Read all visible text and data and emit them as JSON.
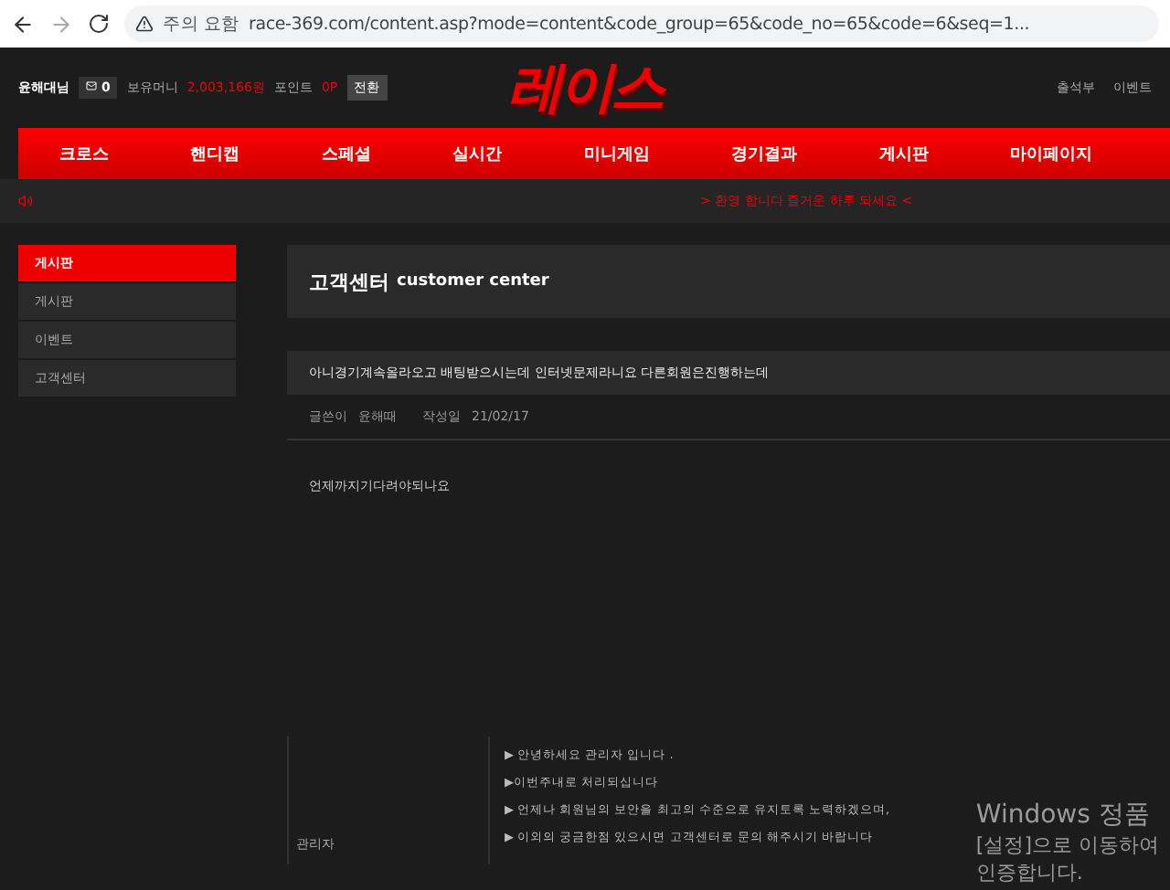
{
  "browser": {
    "warning": "주의 요함",
    "url": "race-369.com/content.asp?mode=content&code_group=65&code_no=65&code=6&seq=1..."
  },
  "header": {
    "user": "윤해대님",
    "message_count": "0",
    "money_label": "보유머니",
    "money": "2,003,166원",
    "point_label": "포인트",
    "point": "0P",
    "convert_button": "전환",
    "logo": "레이스",
    "links": [
      "출석부",
      "이벤트"
    ]
  },
  "nav": [
    "크로스",
    "핸디캡",
    "스페셜",
    "실시간",
    "미니게임",
    "경기결과",
    "게시판",
    "마이페이지"
  ],
  "ticker": "> 환영 합니다 즐거운 하루 되세요 <",
  "sidebar": [
    {
      "label": "게시판",
      "selected": true
    },
    {
      "label": "게시판",
      "selected": false
    },
    {
      "label": "이벤트",
      "selected": false
    },
    {
      "label": "고객센터",
      "selected": false
    }
  ],
  "page_title": {
    "korean": "고객센터",
    "english": "customer center"
  },
  "post": {
    "title": "아니경기계속올라오고 배팅받으시는데 인터넷문제라니요 다른회원은진행하는데",
    "author_label": "글쓴이",
    "author": "윤해때",
    "date_label": "작성일",
    "date": "21/02/17",
    "body": "언제까지기다려야되나요"
  },
  "reply": {
    "author": "관리자",
    "lines": [
      "▶ 안녕하세요 관리자 입니다 .",
      "▶이번주내로 처리되십니다",
      "▶ 언제나 회원님의 보안을 최고의 수준으로 유지토록 노력하겠으며,",
      "▶ 이외의 궁금한점 있으시면 고객센터로 문의 해주시기 바랍니다"
    ]
  },
  "os_notice": [
    "Windows 정품",
    "[설정]으로 이동하여",
    "인증합니다."
  ]
}
